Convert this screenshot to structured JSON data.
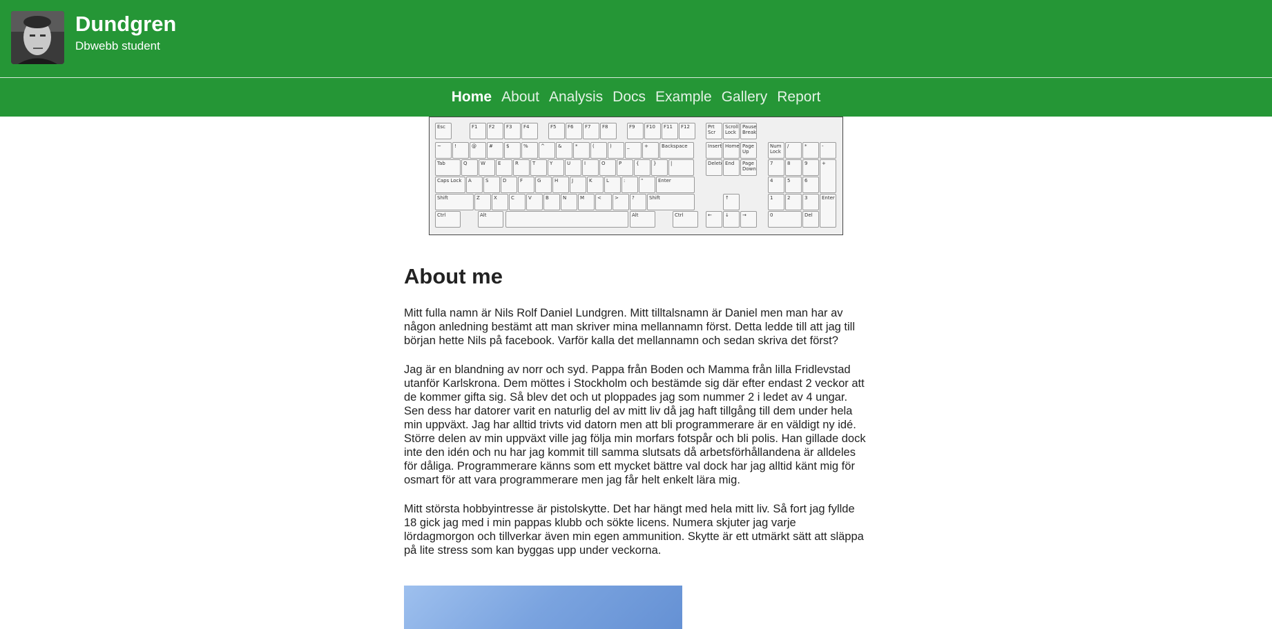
{
  "header": {
    "title": "Dundgren",
    "slogan": "Dbwebb student"
  },
  "nav": {
    "items": [
      {
        "label": "Home",
        "active": true
      },
      {
        "label": "About",
        "active": false
      },
      {
        "label": "Analysis",
        "active": false
      },
      {
        "label": "Docs",
        "active": false
      },
      {
        "label": "Example",
        "active": false
      },
      {
        "label": "Gallery",
        "active": false
      },
      {
        "label": "Report",
        "active": false
      }
    ]
  },
  "keyboard": {
    "keys": [
      "Esc",
      "F1",
      "F2",
      "F3",
      "F4",
      "F5",
      "F6",
      "F7",
      "F8",
      "F9",
      "F10",
      "F11",
      "F12",
      "Prt Scr",
      "Scroll Lock",
      "Pause Break",
      "~",
      "!",
      "@",
      "#",
      "$",
      "%",
      "^",
      "&",
      "*",
      "(",
      ")",
      "_",
      "+",
      "Backspace",
      "Insert",
      "Home",
      "Page Up",
      "Num Lock",
      "/",
      "*",
      "-",
      "Tab",
      "Q",
      "W",
      "E",
      "R",
      "T",
      "Y",
      "U",
      "I",
      "O",
      "P",
      "{",
      "}",
      "|",
      "Delete",
      "End",
      "Page Down",
      "7",
      "8",
      "9",
      "+",
      "Caps Lock",
      "A",
      "S",
      "D",
      "F",
      "G",
      "H",
      "J",
      "K",
      "L",
      ":",
      "\"",
      "Enter",
      "4",
      "5",
      "6",
      "Shift",
      "Z",
      "X",
      "C",
      "V",
      "B",
      "N",
      "M",
      "<",
      ">",
      "?",
      "Shift",
      "↑",
      "1",
      "2",
      "3",
      "Enter",
      "Ctrl",
      "Alt",
      "Alt",
      "Ctrl",
      "←",
      "↓",
      "→",
      "0",
      "Del"
    ]
  },
  "main": {
    "heading": "About me",
    "paragraphs": [
      "Mitt fulla namn är Nils Rolf Daniel Lundgren. Mitt tilltalsnamn är Daniel men man har av någon anledning bestämt att man skriver mina mellannamn först. Detta ledde till att jag till början hette Nils på facebook. Varför kalla det mellannamn och sedan skriva det först?",
      "Jag är en blandning av norr och syd. Pappa från Boden och Mamma från lilla Fridlevstad utanför Karlskrona. Dem möttes i Stockholm och bestämde sig där efter endast 2 veckor att de kommer gifta sig. Så blev det och ut ploppades jag som nummer 2 i ledet av 4 ungar. Sen dess har datorer varit en naturlig del av mitt liv då jag haft tillgång till dem under hela min uppväxt. Jag har alltid trivts vid datorn men att bli programmerare är en väldigt ny idé. Större delen av min uppväxt ville jag följa min morfars fotspår och bli polis. Han gillade dock inte den idén och nu har jag kommit till samma slutsats då arbetsförhållandena är alldeles för dåliga. Programmerare känns som ett mycket bättre val dock har jag alltid känt mig för osmart för att vara programmerare men jag får helt enkelt lära mig.",
      "Mitt största hobbyintresse är pistolskytte. Det har hängt med hela mitt liv. Så fort jag fyllde 18 gick jag med i min pappas klubb och sökte licens. Numera skjuter jag varje lördagmorgon och tillverkar även min egen ammunition. Skytte är ett utmärkt sätt att släppa på lite stress som kan byggas upp under veckorna."
    ]
  }
}
